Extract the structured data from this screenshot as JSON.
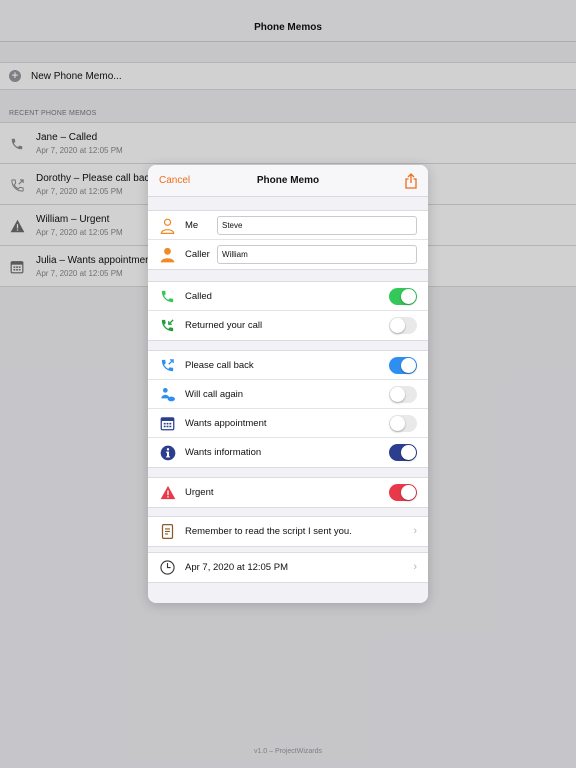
{
  "app": {
    "title": "Phone Memos",
    "new_memo_label": "New Phone Memo...",
    "recent_header": "RECENT PHONE MEMOS",
    "recent": [
      {
        "title": "Jane – Called",
        "date": "Apr 7, 2020 at 12:05 PM",
        "icon": "phone-icon"
      },
      {
        "title": "Dorothy – Please call back",
        "date": "Apr 7, 2020 at 12:05 PM",
        "icon": "phone-outgoing-icon"
      },
      {
        "title": "William – Urgent",
        "date": "Apr 7, 2020 at 12:05 PM",
        "icon": "warning-icon"
      },
      {
        "title": "Julia – Wants appointment",
        "date": "Apr 7, 2020 at 12:05 PM",
        "icon": "calendar-icon"
      }
    ],
    "footer": "v1.0 – ProjectWizards"
  },
  "modal": {
    "title": "Phone Memo",
    "cancel_label": "Cancel",
    "me_label": "Me",
    "me_value": "Steve",
    "caller_label": "Caller",
    "caller_value": "William",
    "called_label": "Called",
    "returned_label": "Returned your call",
    "call_back_label": "Please call back",
    "call_again_label": "Will call again",
    "appointment_label": "Wants appointment",
    "information_label": "Wants information",
    "urgent_label": "Urgent",
    "note": "Remember to read the script I sent you.",
    "date": "Apr 7, 2020 at 12:05 PM",
    "toggles": {
      "called": true,
      "returned": false,
      "call_back": true,
      "call_again": false,
      "appointment": false,
      "information": true,
      "urgent": true
    }
  },
  "colors": {
    "accent": "#f06d1a",
    "green": "#34c759",
    "blue": "#2f8ff0",
    "navy": "#2c3f8e",
    "red": "#e8394a",
    "toggle_off": "#e9e9ea"
  }
}
